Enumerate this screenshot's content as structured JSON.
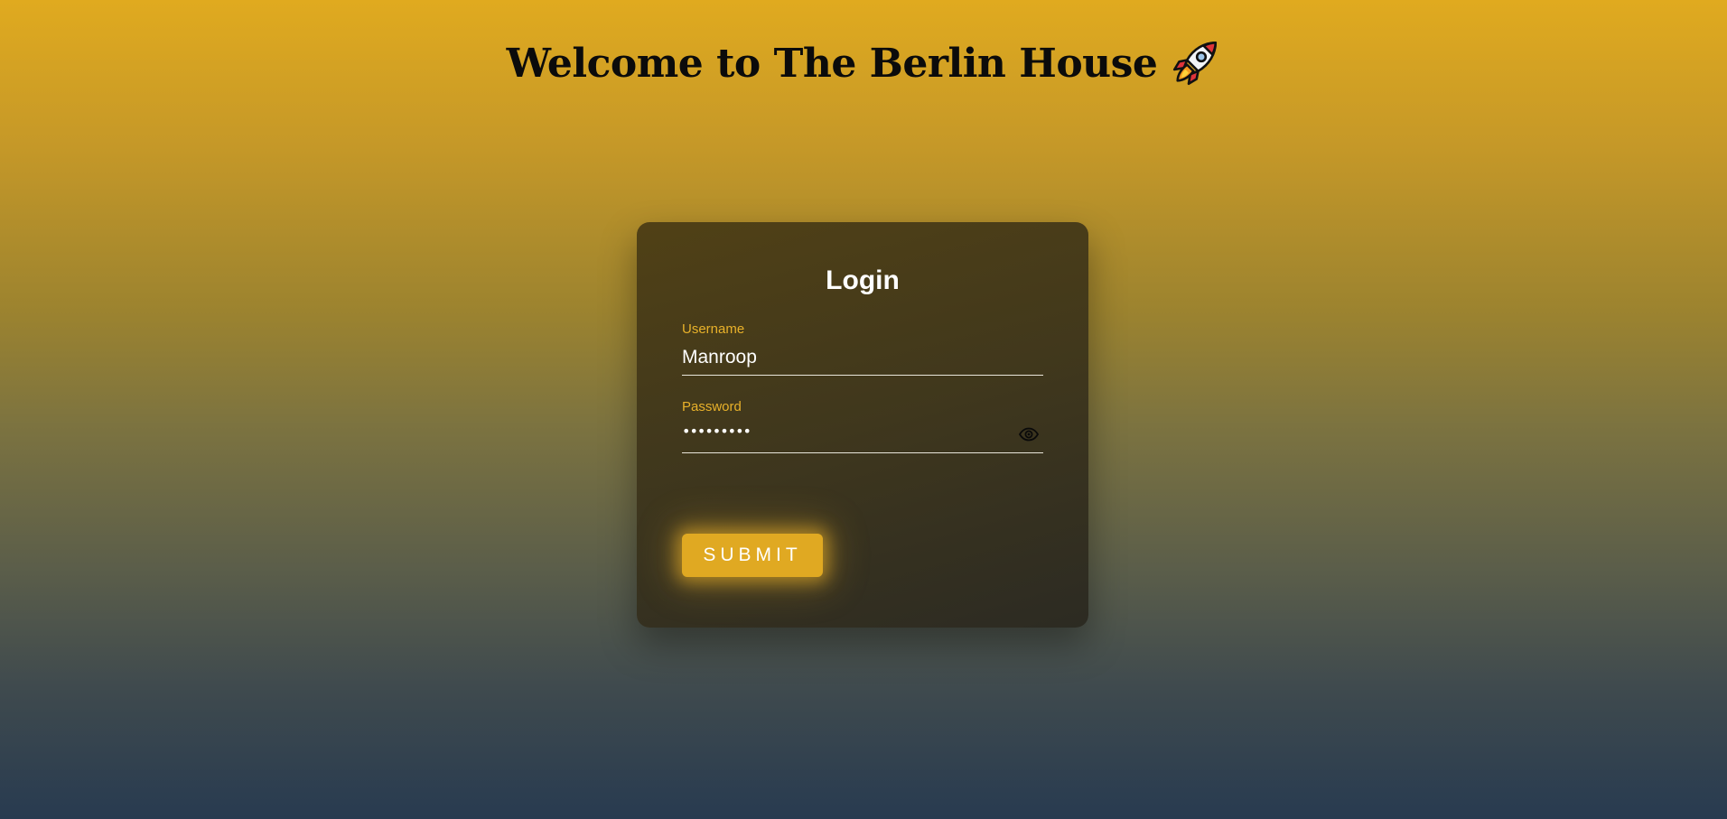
{
  "header": {
    "title": "Welcome to The Berlin House",
    "icon": "rocket-icon"
  },
  "login": {
    "title": "Login",
    "username": {
      "label": "Username",
      "value": "Manroop"
    },
    "password": {
      "label": "Password",
      "masked_value": "•••••••••",
      "toggle_icon": "eye-icon"
    },
    "submit_label": "Submit"
  },
  "colors": {
    "accent": "#e0a922",
    "label": "#e8b12a",
    "background_top": "#e0aa1f",
    "background_bottom": "#283b50"
  }
}
